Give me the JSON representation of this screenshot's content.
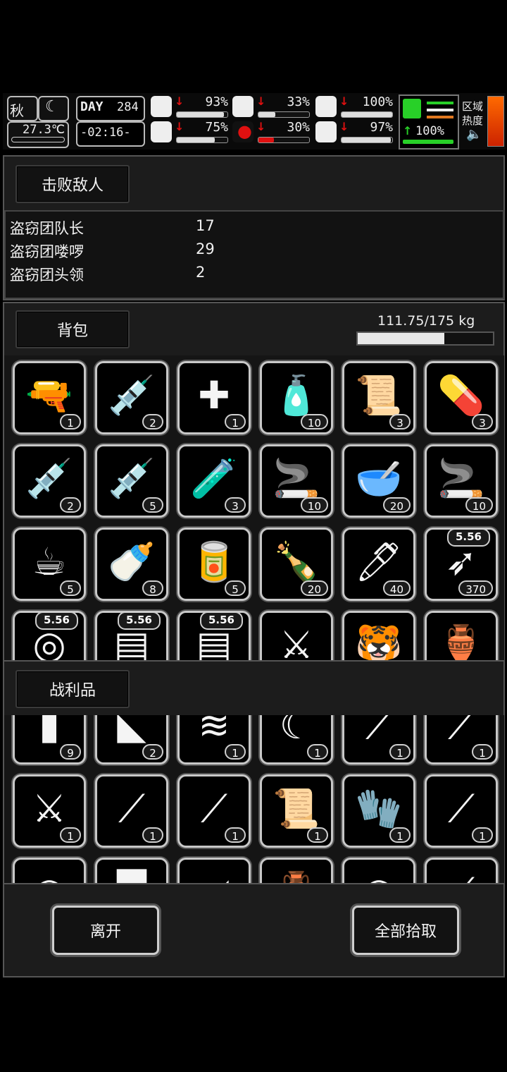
{
  "hud": {
    "season": "秋",
    "temperature": "27.3℃",
    "day_label": "DAY",
    "day_number": "284",
    "clock": "-02:16-",
    "stats": [
      {
        "name": "health",
        "icon": "medkit-icon",
        "value": "93%",
        "level": 0.93,
        "trend": "down"
      },
      {
        "name": "hunger",
        "icon": "stomach-icon",
        "value": "33%",
        "level": 0.33,
        "trend": "down"
      },
      {
        "name": "hydration",
        "icon": "capsule-icon",
        "value": "100%",
        "level": 1.0,
        "trend": "down"
      },
      {
        "name": "mental",
        "icon": "brain-icon",
        "value": "75%",
        "level": 0.75,
        "trend": "down"
      },
      {
        "name": "blood",
        "icon": "blood-drop-icon",
        "value": "30%",
        "level": 0.3,
        "trend": "down"
      },
      {
        "name": "heart",
        "icon": "heart-icon",
        "value": "97%",
        "level": 0.97,
        "trend": "down"
      }
    ],
    "stamina": {
      "value": "100%",
      "level": 1.0,
      "trend": "up"
    },
    "zone_label_1": "区域",
    "zone_label_2": "热度"
  },
  "defeated": {
    "title": "击败敌人",
    "enemies": [
      {
        "name": "盗窃团队长",
        "count": "17"
      },
      {
        "name": "盗窃团喽啰",
        "count": "29"
      },
      {
        "name": "盗窃团头领",
        "count": "2"
      }
    ]
  },
  "backpack": {
    "title": "背包",
    "weight": "111.75/175 kg",
    "weight_fraction": 0.6386,
    "items": [
      {
        "icon": "flare-gun-icon",
        "glyph": "🔫",
        "count": "1"
      },
      {
        "icon": "syringe-icon",
        "glyph": "💉",
        "count": "2"
      },
      {
        "icon": "first-aid-kit-icon",
        "glyph": "✚",
        "count": "1"
      },
      {
        "icon": "medicine-bottle-icon",
        "glyph": "🧴",
        "count": "10"
      },
      {
        "icon": "bandage-roll-icon",
        "glyph": "📜",
        "count": "3"
      },
      {
        "icon": "pill-bottles-icon",
        "glyph": "💊",
        "count": "3"
      },
      {
        "icon": "syringe-icon",
        "glyph": "💉",
        "count": "2"
      },
      {
        "icon": "injector-icon",
        "glyph": "💉",
        "count": "5"
      },
      {
        "icon": "ampoule-icon",
        "glyph": "🧪",
        "count": "3"
      },
      {
        "icon": "cigarette-icon",
        "glyph": "🚬",
        "count": "10"
      },
      {
        "icon": "food-bowl-icon",
        "glyph": "🥣",
        "count": "20"
      },
      {
        "icon": "cigar-icon",
        "glyph": "🚬",
        "count": "10"
      },
      {
        "icon": "coffee-cup-icon",
        "glyph": "☕",
        "count": "5"
      },
      {
        "icon": "water-bottle-icon",
        "glyph": "🍼",
        "count": "8"
      },
      {
        "icon": "canned-food-icon",
        "glyph": "🥫",
        "count": "5"
      },
      {
        "icon": "liquor-bottle-icon",
        "glyph": "🍾",
        "count": "20"
      },
      {
        "icon": "pen-injector-icon",
        "glyph": "🖊",
        "count": "40"
      },
      {
        "icon": "bullet-icon",
        "glyph": "➶",
        "count": "370",
        "caliber": "5.56"
      },
      {
        "icon": "ammo-tape-icon",
        "glyph": "◎",
        "count": "",
        "caliber": "5.56"
      },
      {
        "icon": "ammo-box-icon",
        "glyph": "▤",
        "count": "",
        "caliber": "5.56"
      },
      {
        "icon": "ammo-box-icon",
        "glyph": "▤",
        "count": "",
        "caliber": "5.56"
      },
      {
        "icon": "machete-icon",
        "glyph": "⚔",
        "count": ""
      },
      {
        "icon": "tiger-mask-icon",
        "glyph": "🐯",
        "count": ""
      },
      {
        "icon": "vase-icon",
        "glyph": "🏺",
        "count": ""
      }
    ]
  },
  "loot": {
    "title": "战利品",
    "items": [
      {
        "icon": "knife-icon",
        "glyph": "▮",
        "count": "9"
      },
      {
        "icon": "cloth-icon",
        "glyph": "◣",
        "count": "2"
      },
      {
        "icon": "stacked-plates-icon",
        "glyph": "≋",
        "count": "1"
      },
      {
        "icon": "sickle-icon",
        "glyph": "☾",
        "count": "1"
      },
      {
        "icon": "screwdriver-icon",
        "glyph": "⟋",
        "count": "1"
      },
      {
        "icon": "sword-icon",
        "glyph": "⟋",
        "count": "1"
      },
      {
        "icon": "curved-sword-icon",
        "glyph": "⚔",
        "count": "1"
      },
      {
        "icon": "spear-icon",
        "glyph": "⟋",
        "count": "1"
      },
      {
        "icon": "rapier-icon",
        "glyph": "⟋",
        "count": "1"
      },
      {
        "icon": "paper-roll-icon",
        "glyph": "📜",
        "count": "1"
      },
      {
        "icon": "gloves-icon",
        "glyph": "🧤",
        "count": "1"
      },
      {
        "icon": "spiked-club-icon",
        "glyph": "⟋",
        "count": "1"
      },
      {
        "icon": "item-icon",
        "glyph": "◠",
        "count": ""
      },
      {
        "icon": "item-icon",
        "glyph": "▀",
        "count": ""
      },
      {
        "icon": "item-icon",
        "glyph": "◢",
        "count": ""
      },
      {
        "icon": "vase-icon",
        "glyph": "🏺",
        "count": ""
      },
      {
        "icon": "item-icon",
        "glyph": "◠",
        "count": ""
      },
      {
        "icon": "item-icon",
        "glyph": "⟋",
        "count": ""
      }
    ]
  },
  "actions": {
    "leave": "离开",
    "take_all": "全部拾取"
  }
}
